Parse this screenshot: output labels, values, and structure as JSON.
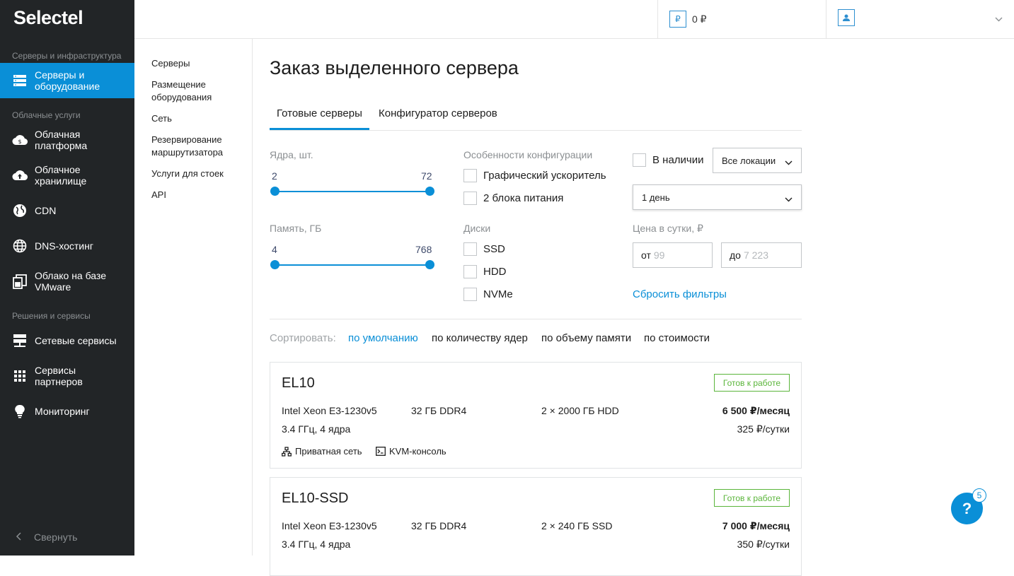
{
  "sidebar": {
    "logo": "Selectel",
    "sections": [
      "Серверы и инфраструктура",
      "Облачные услуги",
      "Решения и сервисы"
    ],
    "items": [
      {
        "label": "Серверы и оборудование",
        "icon": "server-icon"
      },
      {
        "label": "Облачная платформа",
        "icon": "cloud-platform-icon"
      },
      {
        "label": "Облачное хранилище",
        "icon": "cloud-upload-icon"
      },
      {
        "label": "CDN",
        "icon": "globe-icon"
      },
      {
        "label": "DNS-хостинг",
        "icon": "globe-grid-icon"
      },
      {
        "label": "Облако на базе VMware",
        "icon": "vmware-icon"
      },
      {
        "label": "Сетевые сервисы",
        "icon": "network-icon"
      },
      {
        "label": "Сервисы партнеров",
        "icon": "grid-icon"
      },
      {
        "label": "Мониторинг",
        "icon": "bulb-icon"
      }
    ],
    "collapse_label": "Свернуть"
  },
  "topbar": {
    "currency_icon": "₽",
    "balance": "0 ₽"
  },
  "subnav": [
    "Серверы",
    "Размещение оборудования",
    "Сеть",
    "Резервирование маршрутизатора",
    "Услуги для стоек",
    "API"
  ],
  "main": {
    "title": "Заказ выделенного сервера",
    "tabs": [
      "Готовые серверы",
      "Конфигуратор серверов"
    ],
    "filters": {
      "cores_label": "Ядра, шт.",
      "cores_min": "2",
      "cores_max": "72",
      "memory_label": "Память, ГБ",
      "memory_min": "4",
      "memory_max": "768",
      "features_label": "Особенности конфигурации",
      "features": [
        "Графический ускоритель",
        "2 блока питания"
      ],
      "disks_label": "Диски",
      "disks": [
        "SSD",
        "HDD",
        "NVMe"
      ],
      "in_stock_label": "В наличии",
      "location": "Все локации",
      "period": "1 день",
      "price_label": "Цена в сутки,  ₽",
      "price_from_prefix": "от",
      "price_from_placeholder": "99",
      "price_to_prefix": "до",
      "price_to_placeholder": "7 223",
      "reset_label": "Сбросить фильтры"
    },
    "sort": {
      "label": "Сортировать:",
      "options": [
        "по умолчанию",
        "по количеству ядер",
        "по объему памяти",
        "по стоимости"
      ]
    },
    "servers": [
      {
        "name": "EL10",
        "status": "Готов к работе",
        "cpu": "Intel Xeon E3-1230v5",
        "cpu_detail": "3.4 ГГц, 4 ядра",
        "ram": "32 ГБ DDR4",
        "disk": "2 × 2000 ГБ HDD",
        "price_month": "6 500 ₽/месяц",
        "price_day": "325 ₽/сутки",
        "features": [
          "Приватная сеть",
          "KVM-консоль"
        ]
      },
      {
        "name": "EL10-SSD",
        "status": "Готов к работе",
        "cpu": "Intel Xeon E3-1230v5",
        "cpu_detail": "3.4 ГГц, 4 ядра",
        "ram": "32 ГБ DDR4",
        "disk": "2 × 240 ГБ SSD",
        "price_month": "7 000 ₽/месяц",
        "price_day": "350 ₽/сутки"
      }
    ]
  },
  "help": {
    "label": "?",
    "badge": "5"
  }
}
